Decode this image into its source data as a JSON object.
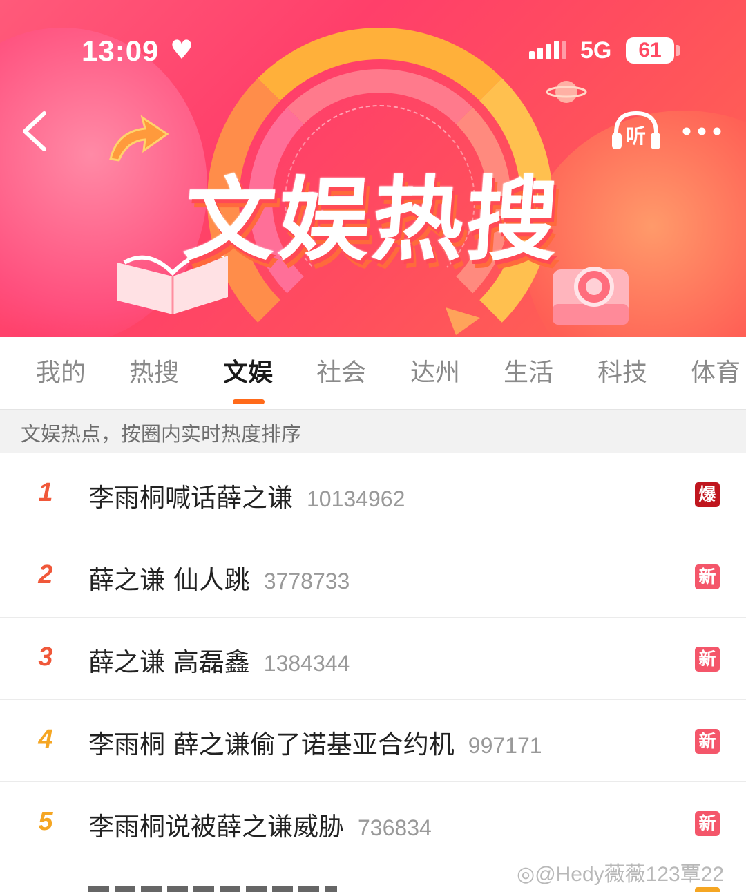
{
  "status_bar": {
    "time": "13:09",
    "network": "5G",
    "battery": "61"
  },
  "banner": {
    "title": "文娱热搜",
    "listen_label": "听"
  },
  "tabs": [
    {
      "label": "我的",
      "active": false
    },
    {
      "label": "热搜",
      "active": false
    },
    {
      "label": "文娱",
      "active": true
    },
    {
      "label": "社会",
      "active": false
    },
    {
      "label": "达州",
      "active": false
    },
    {
      "label": "生活",
      "active": false
    },
    {
      "label": "科技",
      "active": false
    },
    {
      "label": "体育",
      "active": false
    }
  ],
  "notice": "文娱热点，按圈内实时热度排序",
  "items": [
    {
      "rank": "1",
      "title": "李雨桐喊话薛之谦",
      "count": "10134962",
      "badge": "爆"
    },
    {
      "rank": "2",
      "title": "薛之谦 仙人跳",
      "count": "3778733",
      "badge": "新"
    },
    {
      "rank": "3",
      "title": "薛之谦 高磊鑫",
      "count": "1384344",
      "badge": "新"
    },
    {
      "rank": "4",
      "title": "李雨桐 薛之谦偷了诺基亚合约机",
      "count": "997171",
      "badge": "新"
    },
    {
      "rank": "5",
      "title": "李雨桐说被薛之谦威胁",
      "count": "736834",
      "badge": "新"
    }
  ],
  "watermark": "@Hedy薇薇123覃22",
  "colors": {
    "rank_top3": "#f0583a",
    "rank_other": "#f5a623",
    "badge_hot": "#c0161e",
    "badge_new": "#f4566a",
    "tab_indicator": "#ff6a1a"
  }
}
